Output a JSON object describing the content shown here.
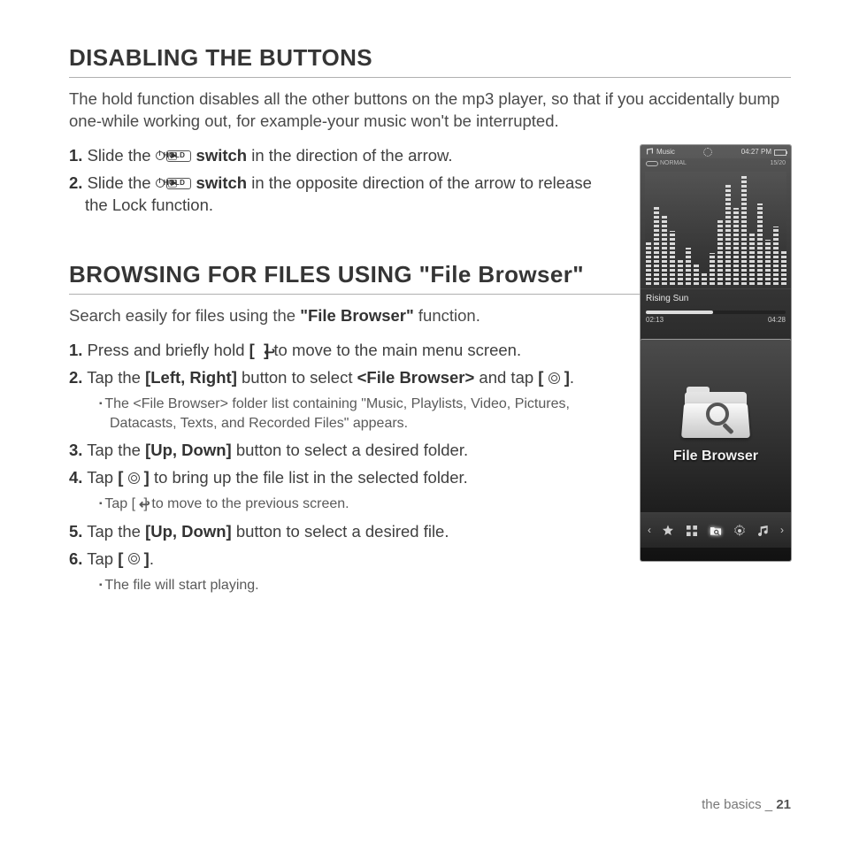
{
  "section1": {
    "heading": "DISABLING THE BUTTONS",
    "intro": "The hold function disables all the other buttons on the mp3 player, so that if you accidentally bump one-while working out, for example-your music won't be interrupted.",
    "step1_a": "Slide the ",
    "step1_b": " switch",
    "step1_c": " in the direction of the arrow.",
    "step2_a": "Slide the ",
    "step2_b": " switch",
    "step2_c": " in the opposite direction of the arrow to release the Lock function.",
    "hold_label": "HOLD"
  },
  "device_music": {
    "title": "Music",
    "time": "04:27 PM",
    "counter": "15/20",
    "mode": "NORMAL",
    "song": "Rising Sun",
    "elapsed": "02:13",
    "total": "04:28",
    "eq_bars": [
      38,
      70,
      62,
      48,
      24,
      33,
      18,
      12,
      28,
      58,
      90,
      68,
      96,
      46,
      72,
      40,
      52,
      30
    ]
  },
  "section2": {
    "heading": "BROWSING FOR FILES USING \"File Browser\"",
    "intro_a": "Search easily for files using the ",
    "intro_b": "\"File Browser\"",
    "intro_c": " function.",
    "step1_a": "Press and briefly hold ",
    "step1_b": " to move to the main menu screen.",
    "step2_a": "Tap the ",
    "step2_b": "[Left, Right]",
    "step2_c": " button to select ",
    "step2_d": "<File Browser>",
    "step2_e": " and tap ",
    "step2_sub": "The <File Browser> folder list containing \"Music, Playlists, Video, Pictures, Datacasts, Texts, and Recorded Files\" appears.",
    "step3_a": "Tap the ",
    "step3_b": "[Up, Down]",
    "step3_c": " button to select a desired folder.",
    "step4_a": "Tap ",
    "step4_b": " to bring up the file list in the selected folder.",
    "step4_sub_a": "Tap [ ",
    "step4_sub_b": " ] to move to the previous screen.",
    "step5_a": "Tap the ",
    "step5_b": "[Up, Down]",
    "step5_c": " button to select a desired file.",
    "step6_a": "Tap ",
    "step6_sub": "The file will start playing."
  },
  "device_fb": {
    "label": "File Browser"
  },
  "footer": {
    "chapter": "the basics _ ",
    "page": "21"
  }
}
